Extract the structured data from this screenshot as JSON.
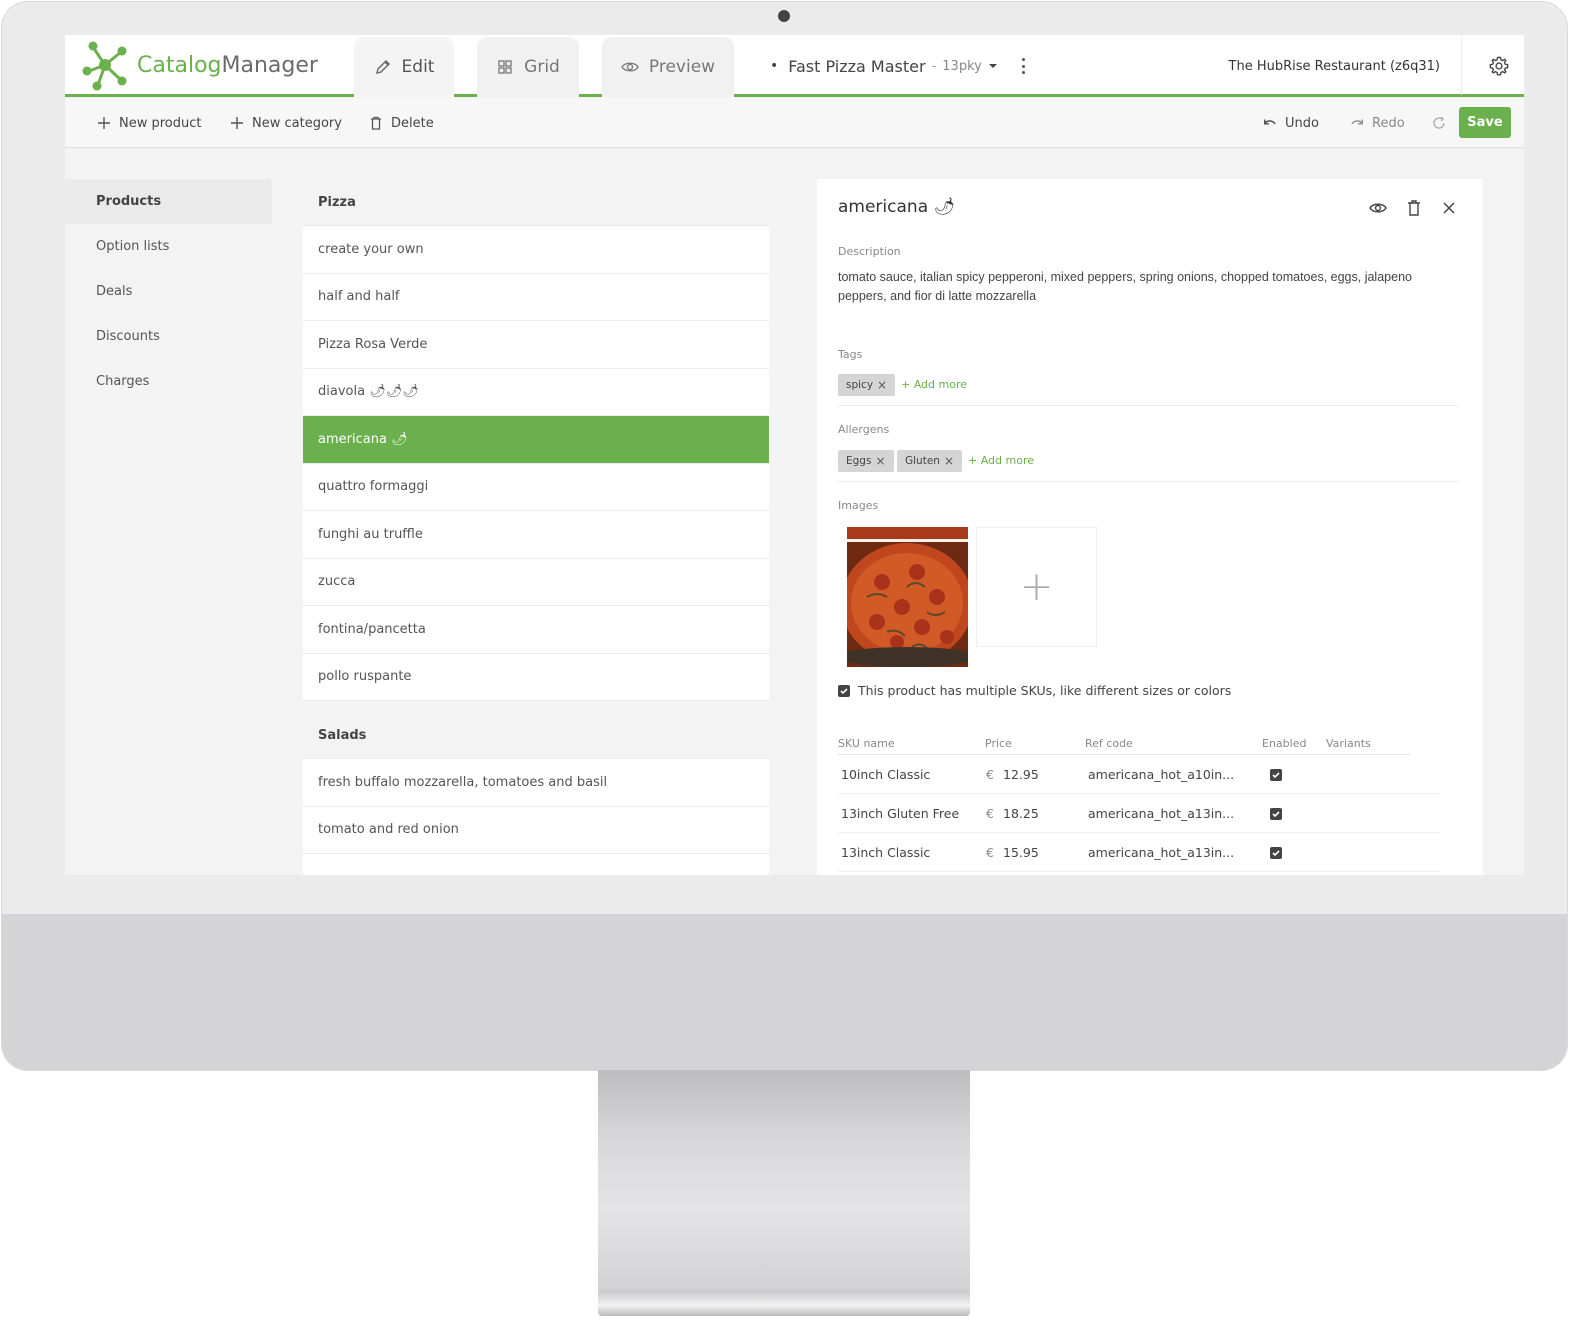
{
  "header": {
    "logo_part1": "Catalog",
    "logo_part2": "Manager",
    "tabs": [
      {
        "label": "Edit"
      },
      {
        "label": "Grid"
      },
      {
        "label": "Preview"
      }
    ],
    "catalog_name": "Fast Pizza Master",
    "catalog_separator": "-",
    "catalog_version": "13pky",
    "account": "The HubRise Restaurant (z6q31)"
  },
  "toolbar": {
    "new_product": "New product",
    "new_category": "New category",
    "delete": "Delete",
    "undo": "Undo",
    "redo": "Redo",
    "save": "Save"
  },
  "sidebar": {
    "items": [
      {
        "label": "Products"
      },
      {
        "label": "Option lists"
      },
      {
        "label": "Deals"
      },
      {
        "label": "Discounts"
      },
      {
        "label": "Charges"
      }
    ]
  },
  "categories": [
    {
      "name": "Pizza",
      "products": [
        "create your own",
        "half and half",
        "Pizza Rosa Verde",
        "diavola 🌶🌶🌶",
        "americana 🌶",
        "quattro formaggi",
        "funghi au truffle",
        "zucca",
        "fontina/pancetta",
        "pollo ruspante"
      ]
    },
    {
      "name": "Salads",
      "products": [
        "fresh buffalo mozzarella, tomatoes and basil",
        "tomato and red onion"
      ]
    }
  ],
  "detail": {
    "title": "americana 🌶",
    "description_label": "Description",
    "description": "tomato sauce, italian spicy pepperoni, mixed peppers, spring onions, chopped tomatoes, eggs, jalapeno peppers, and fior di latte mozzarella",
    "tags_label": "Tags",
    "tags": [
      "spicy"
    ],
    "allergens_label": "Allergens",
    "allergens": [
      "Eggs",
      "Gluten"
    ],
    "add_more": "+ Add more",
    "images_label": "Images",
    "image_add": "+",
    "multi_sku_label": "This product has multiple SKUs, like different sizes or colors",
    "multi_sku_checked": true,
    "sku_headers": {
      "name": "SKU name",
      "price": "Price",
      "ref": "Ref code",
      "enabled": "Enabled",
      "variants": "Variants"
    },
    "currency": "€",
    "skus": [
      {
        "name": "10inch Classic",
        "price": "12.95",
        "ref": "americana_hot_a10in...",
        "enabled": true
      },
      {
        "name": "13inch Gluten Free",
        "price": "18.25",
        "ref": "americana_hot_a13in...",
        "enabled": true
      },
      {
        "name": "13inch Classic",
        "price": "15.95",
        "ref": "americana_hot_a13in...",
        "enabled": true
      }
    ]
  },
  "colors": {
    "accent": "#6ab04c",
    "active_row": "#6ab04c"
  }
}
